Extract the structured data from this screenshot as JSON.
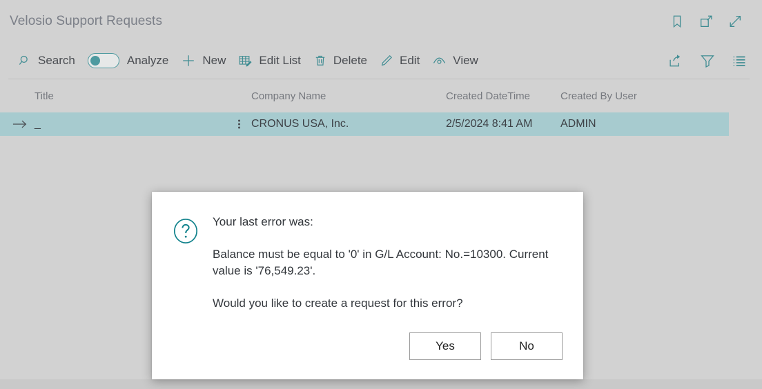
{
  "window": {
    "title": "Velosio Support Requests",
    "header_icons": [
      {
        "name": "bookmark-icon",
        "label": "Bookmark"
      },
      {
        "name": "open-in-new-window-icon",
        "label": "Open in new window"
      },
      {
        "name": "expand-icon",
        "label": "Expand"
      }
    ]
  },
  "toolbar": {
    "search_label": "Search",
    "analyze_label": "Analyze",
    "analyze_toggle_state": "off",
    "new_label": "New",
    "edit_list_label": "Edit List",
    "delete_label": "Delete",
    "edit_label": "Edit",
    "view_label": "View",
    "right_icons": [
      {
        "name": "share-icon",
        "label": "Share"
      },
      {
        "name": "filter-icon",
        "label": "Filter"
      },
      {
        "name": "list-options-icon",
        "label": "List options"
      }
    ]
  },
  "grid": {
    "columns": [
      "Title",
      "Company Name",
      "Created DateTime",
      "Created By User"
    ],
    "rows": [
      {
        "title": "_",
        "company_name": "CRONUS USA, Inc.",
        "created_datetime": "2/5/2024 8:41 AM",
        "created_by_user": "ADMIN",
        "selected": true
      }
    ]
  },
  "dialog": {
    "icon": "question-mark-icon",
    "line1": "Your last error was:",
    "line2": "Balance must be equal to '0' in G/L Account: No.=10300. Current value is '76,549.23'.",
    "line3": "Would you like to create a request for this error?",
    "yes_label": "Yes",
    "no_label": "No"
  },
  "colors": {
    "accent_teal": "#3f8c92",
    "selected_row": "#a7cbcf",
    "page_background": "#d2d2d2",
    "title_text": "#7b7f88"
  }
}
